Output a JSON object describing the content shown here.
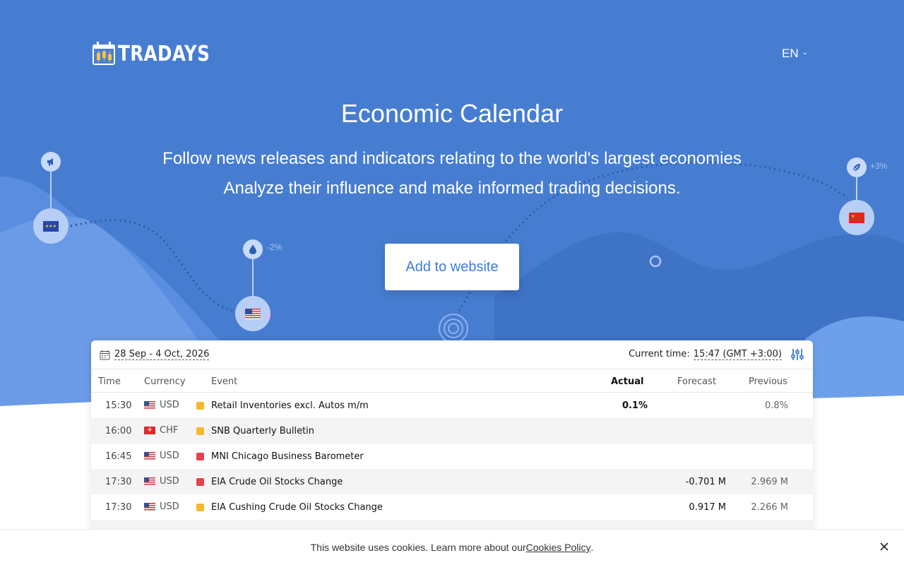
{
  "brand": {
    "name": "TRADAYS"
  },
  "header": {
    "language": "EN"
  },
  "hero": {
    "title": "Economic Calendar",
    "subtitle_line1": "Follow news releases and indicators relating to the world's largest economies",
    "subtitle_line2": "Analyze their influence and make informed trading decisions.",
    "add_button_label": "Add to website",
    "node_labels": {
      "us_change": "-2%",
      "cn_change": "+3%"
    }
  },
  "calendar": {
    "date_range": "28 Sep - 4 Oct, 2026",
    "current_time_label": "Current time:",
    "current_time_value": "15:47 (GMT +3:00)",
    "columns": {
      "time": "Time",
      "currency": "Currency",
      "event": "Event",
      "actual": "Actual",
      "forecast": "Forecast",
      "previous": "Previous"
    },
    "rows": [
      {
        "time": "15:30",
        "currency": "USD",
        "flag": "us",
        "importance": "medium",
        "event": "Retail Inventories excl. Autos m/m",
        "actual": "0.1%",
        "forecast": "",
        "previous": "0.8%"
      },
      {
        "time": "16:00",
        "currency": "CHF",
        "flag": "ch",
        "importance": "medium",
        "event": "SNB Quarterly Bulletin",
        "actual": "",
        "forecast": "",
        "previous": ""
      },
      {
        "time": "16:45",
        "currency": "USD",
        "flag": "us",
        "importance": "high",
        "event": "MNI Chicago Business Barometer",
        "actual": "",
        "forecast": "",
        "previous": ""
      },
      {
        "time": "17:30",
        "currency": "USD",
        "flag": "us",
        "importance": "high",
        "event": "EIA Crude Oil Stocks Change",
        "actual": "",
        "forecast": "-0.701 M",
        "previous": "2.969 M"
      },
      {
        "time": "17:30",
        "currency": "USD",
        "flag": "us",
        "importance": "medium",
        "event": "EIA Cushing Crude Oil Stocks Change",
        "actual": "",
        "forecast": "0.917 M",
        "previous": "2.266 M"
      }
    ],
    "importance_colors": {
      "medium": "#f5b82e",
      "high": "#e5434b"
    }
  },
  "cookie_banner": {
    "text": "This website uses cookies. Learn more about our ",
    "link": "Cookies Policy",
    "suffix": "."
  },
  "colors": {
    "hero_bg": "#4a7fd4",
    "accent": "#3b7ed6"
  }
}
